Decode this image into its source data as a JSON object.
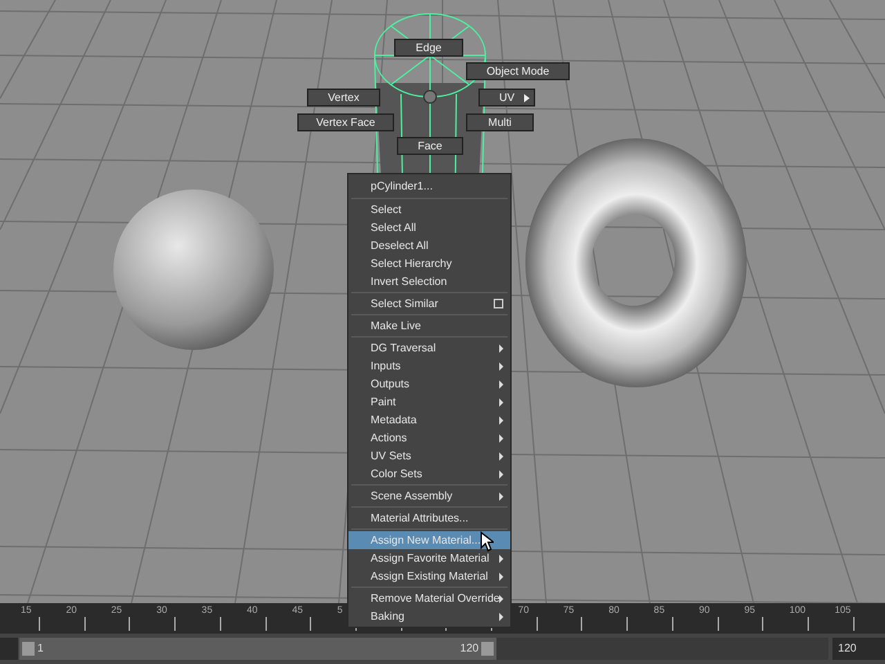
{
  "marking_menu": [
    {
      "label": "Edge",
      "submenu": false
    },
    {
      "label": "Object Mode",
      "submenu": false
    },
    {
      "label": "Vertex",
      "submenu": false
    },
    {
      "label": "UV",
      "submenu": true
    },
    {
      "label": "Vertex Face",
      "submenu": false
    },
    {
      "label": "Multi",
      "submenu": false
    },
    {
      "label": "Face",
      "submenu": false
    }
  ],
  "context_menu": [
    {
      "kind": "header",
      "label": "pCylinder1..."
    },
    {
      "kind": "separator"
    },
    {
      "kind": "item",
      "label": "Select",
      "selected": false
    },
    {
      "kind": "item",
      "label": "Select All",
      "selected": false
    },
    {
      "kind": "item",
      "label": "Deselect All",
      "selected": false
    },
    {
      "kind": "item",
      "label": "Select Hierarchy",
      "selected": false
    },
    {
      "kind": "item",
      "label": "Invert Selection",
      "selected": false
    },
    {
      "kind": "separator"
    },
    {
      "kind": "option",
      "label": "Select Similar",
      "selected": false
    },
    {
      "kind": "separator"
    },
    {
      "kind": "item",
      "label": "Make Live",
      "selected": false
    },
    {
      "kind": "separator"
    },
    {
      "kind": "submenu",
      "label": "DG Traversal",
      "selected": false
    },
    {
      "kind": "submenu",
      "label": "Inputs",
      "selected": false
    },
    {
      "kind": "submenu",
      "label": "Outputs",
      "selected": false
    },
    {
      "kind": "submenu",
      "label": "Paint",
      "selected": false
    },
    {
      "kind": "submenu",
      "label": "Metadata",
      "selected": false
    },
    {
      "kind": "submenu",
      "label": "Actions",
      "selected": false
    },
    {
      "kind": "submenu",
      "label": "UV Sets",
      "selected": false
    },
    {
      "kind": "submenu",
      "label": "Color Sets",
      "selected": false
    },
    {
      "kind": "separator"
    },
    {
      "kind": "submenu",
      "label": "Scene Assembly",
      "selected": false
    },
    {
      "kind": "separator"
    },
    {
      "kind": "item",
      "label": "Material Attributes...",
      "selected": false
    },
    {
      "kind": "separator"
    },
    {
      "kind": "item",
      "label": "Assign New Material...",
      "selected": true
    },
    {
      "kind": "submenu",
      "label": "Assign Favorite Material",
      "selected": false
    },
    {
      "kind": "submenu",
      "label": "Assign Existing Material",
      "selected": false
    },
    {
      "kind": "separator"
    },
    {
      "kind": "submenu",
      "label": "Remove Material Override",
      "selected": false
    },
    {
      "kind": "submenu",
      "label": "Baking",
      "selected": false
    }
  ],
  "timeline": {
    "ticks": [
      "15",
      "20",
      "25",
      "30",
      "35",
      "40",
      "45",
      "5",
      "70",
      "75",
      "80",
      "85",
      "90",
      "95",
      "100",
      "105"
    ]
  },
  "range_slider": {
    "start": "1",
    "end": "120",
    "level": 0.59,
    "end_field": "120"
  }
}
